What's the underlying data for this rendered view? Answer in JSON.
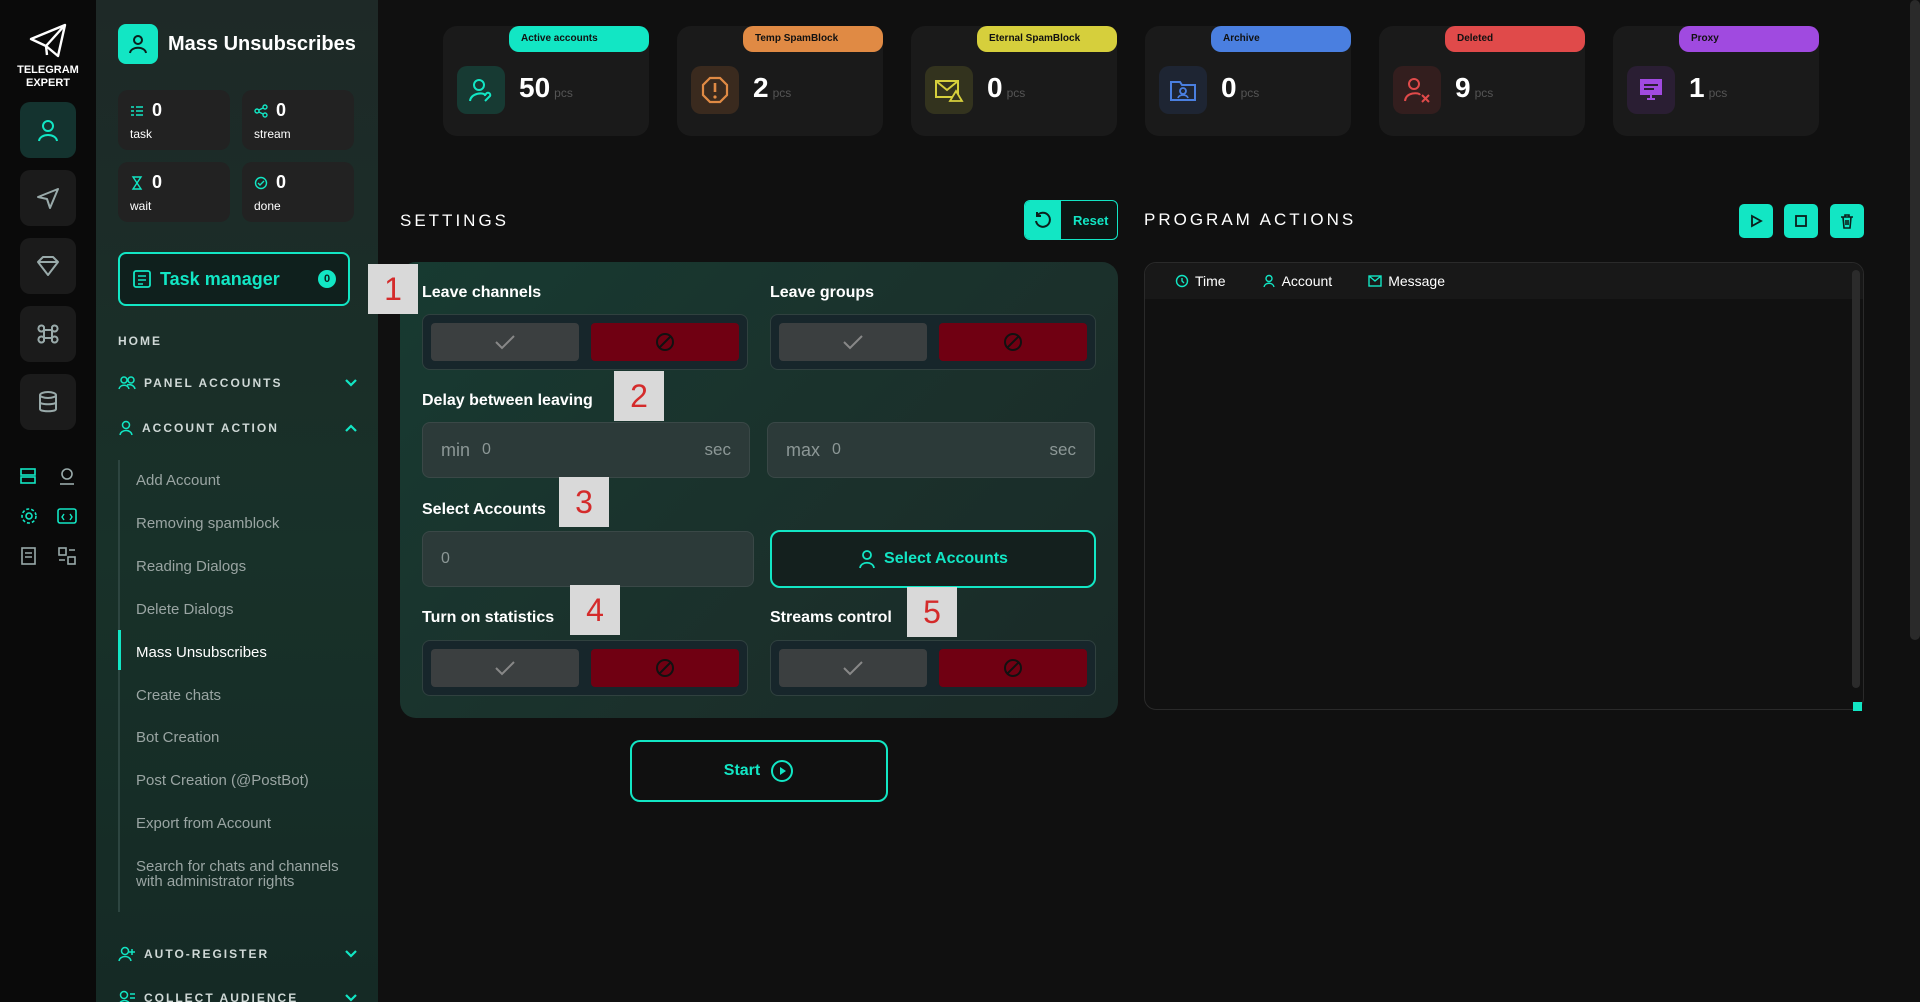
{
  "app": {
    "logo_line1": "TELEGRAM",
    "logo_line2": "EXPERT"
  },
  "rail": {
    "items": [
      "accounts-icon",
      "send-icon",
      "diamond-icon",
      "command-icon",
      "database-icon"
    ],
    "active_index": 0
  },
  "sidebar": {
    "title": "Mass Unsubscribes",
    "stats": [
      {
        "label": "task",
        "value": "0"
      },
      {
        "label": "stream",
        "value": "0"
      },
      {
        "label": "wait",
        "value": "0"
      },
      {
        "label": "done",
        "value": "0"
      }
    ],
    "task_manager": {
      "label": "Task manager",
      "count": "0"
    },
    "home": "HOME",
    "panel_accounts": "PANEL ACCOUNTS",
    "account_action": "ACCOUNT ACTION",
    "items": [
      "Add Account",
      "Removing spamblock",
      "Reading Dialogs",
      "Delete Dialogs",
      "Mass Unsubscribes",
      "Create chats",
      "Bot Creation",
      "Post Creation (@PostBot)",
      "Export from Account",
      "Search for chats and channels with administrator rights"
    ],
    "active_item": "Mass Unsubscribes",
    "auto_register": "AUTO-REGISTER",
    "collect_audience": "COLLECT AUDIENCE"
  },
  "cards": [
    {
      "label": "Active accounts",
      "value": "50",
      "unit": "pcs",
      "color": "#12e6c4"
    },
    {
      "label": "Temp SpamBlock",
      "value": "2",
      "unit": "pcs",
      "color": "#e08a44"
    },
    {
      "label": "Eternal SpamBlock",
      "value": "0",
      "unit": "pcs",
      "color": "#d6cf3c"
    },
    {
      "label": "Archive",
      "value": "0",
      "unit": "pcs",
      "color": "#4a7fe0"
    },
    {
      "label": "Deleted",
      "value": "9",
      "unit": "pcs",
      "color": "#e04a4a"
    },
    {
      "label": "Proxy",
      "value": "1",
      "unit": "pcs",
      "color": "#a04ae0"
    }
  ],
  "settings": {
    "title": "SETTINGS",
    "reset": "Reset",
    "leave_channels": "Leave channels",
    "leave_groups": "Leave groups",
    "delay": "Delay between leaving",
    "min_prefix": "min",
    "min_value": "0",
    "max_prefix": "max",
    "max_value": "0",
    "unit": "sec",
    "select_accounts": "Select Accounts",
    "selected_count": "0",
    "select_button": "Select Accounts",
    "statistics": "Turn on statistics",
    "streams": "Streams control",
    "start": "Start",
    "badges": [
      "1",
      "2",
      "3",
      "4",
      "5"
    ]
  },
  "actions": {
    "title": "PROGRAM ACTIONS",
    "columns": [
      "Time",
      "Account",
      "Message"
    ]
  }
}
